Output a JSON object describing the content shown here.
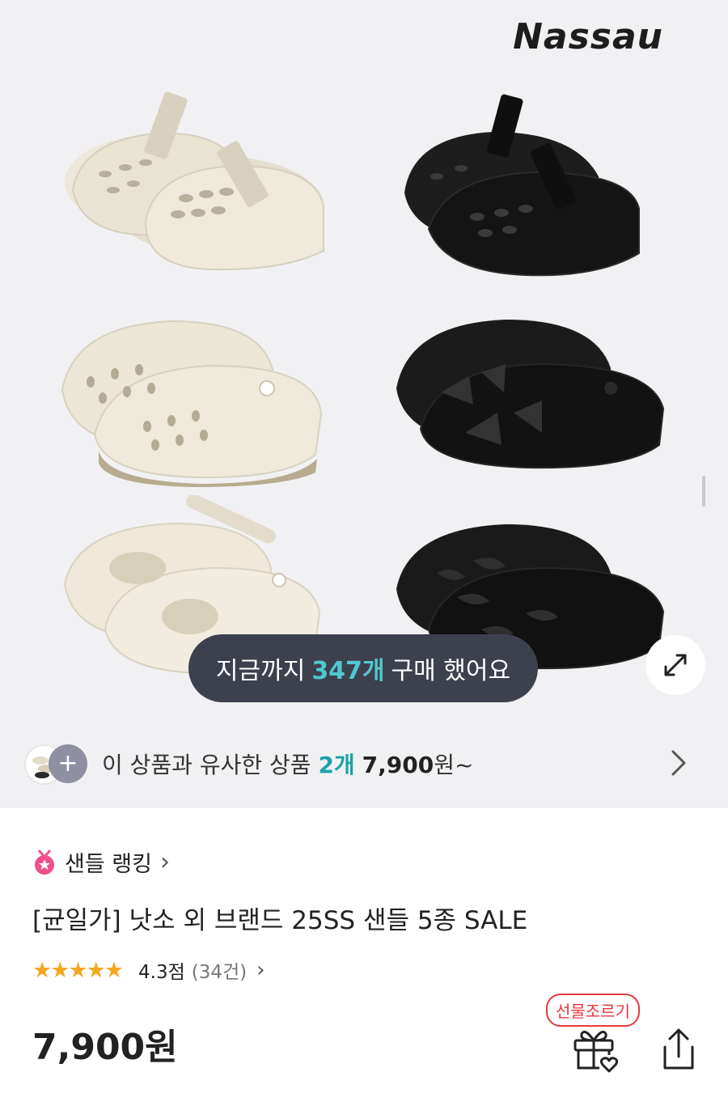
{
  "hero": {
    "brand": "Nassau",
    "purchase_toast": {
      "prefix": "지금까지",
      "count": "347개",
      "suffix": "구매 했어요"
    },
    "image_index_fraction": 0.0,
    "products": [
      {
        "name": "beige-strap-sandal-icon",
        "color": "#e8e2d3"
      },
      {
        "name": "black-strap-sandal-icon",
        "color": "#1a1a1a"
      },
      {
        "name": "beige-clog-icon",
        "color": "#ece6d6"
      },
      {
        "name": "black-clog-icon",
        "color": "#141414"
      },
      {
        "name": "beige-cutout-clog-icon",
        "color": "#efe8da"
      },
      {
        "name": "black-wave-clog-icon",
        "color": "#161616"
      }
    ]
  },
  "similar": {
    "prefix": "이 상품과 유사한 상품",
    "count": "2개",
    "price": "7,900",
    "suffix": "원~",
    "plus_icon": "+"
  },
  "ranking": {
    "label": "샌들 랭킹",
    "chevron": "›"
  },
  "product": {
    "title": "[균일가] 낫소 외 브랜드 25SS 샌들 5종 SALE",
    "stars_display": "★★★★★",
    "rating_value": 4.3,
    "rating_text": "4.3점",
    "review_count": "(34건)",
    "review_chevron": "›",
    "price": "7,900원"
  },
  "actions": {
    "gift_badge": "선물조르기",
    "gift_icon": "gift-heart-icon",
    "share_icon": "share-icon"
  },
  "colors": {
    "accent_teal": "#1aa3a8",
    "toast_teal": "#4fc8cf",
    "star": "#f5a623",
    "gift_red": "#e8373d"
  }
}
